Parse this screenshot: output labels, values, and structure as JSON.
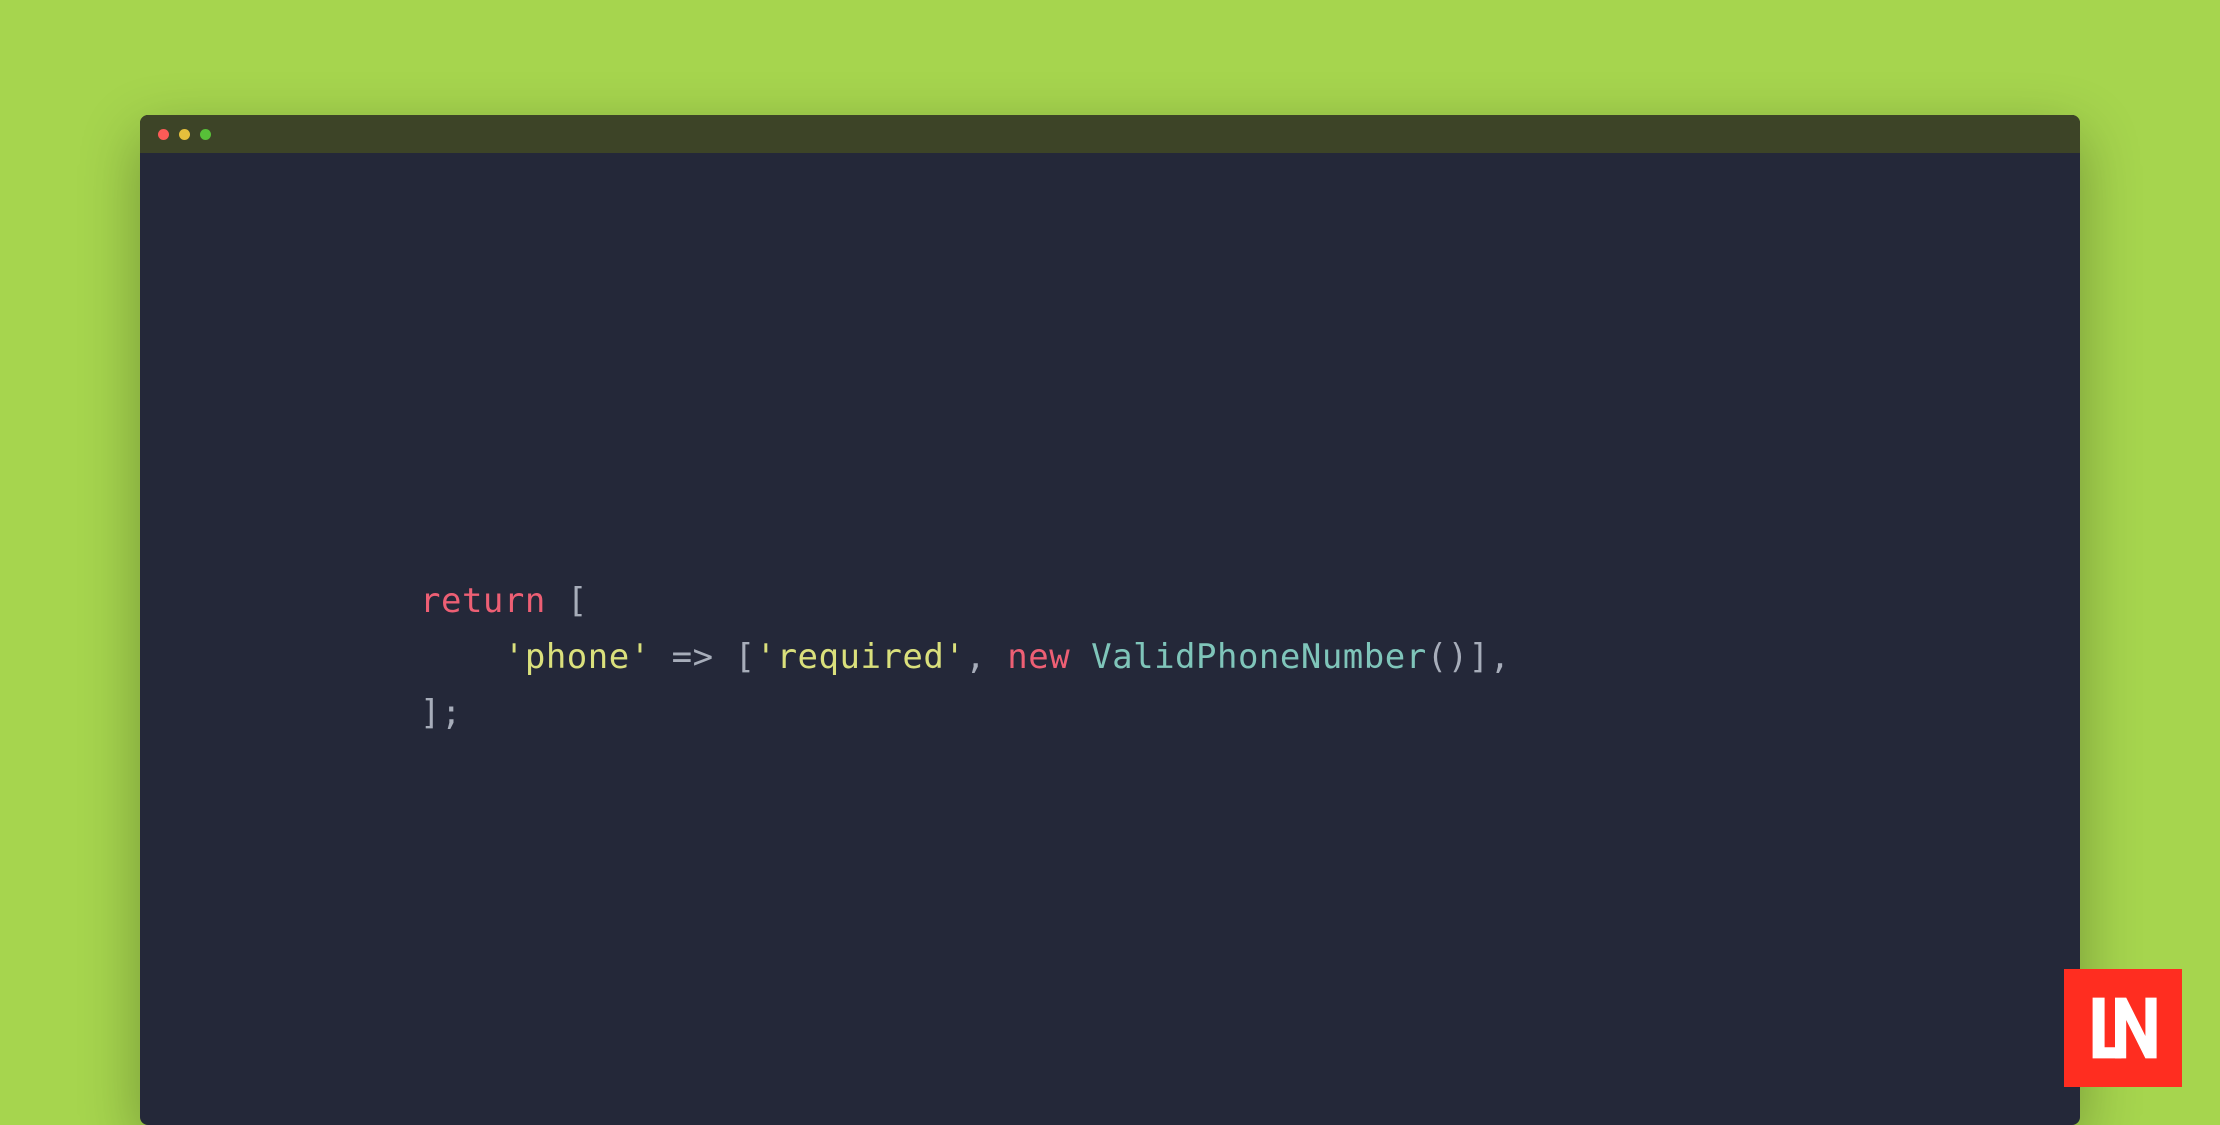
{
  "colors": {
    "background": "#a6d54e",
    "editor_bg": "#242839",
    "titlebar_bg": "#3d4427",
    "traffic_red": "#fc5b57",
    "traffic_yellow": "#e5bf3c",
    "traffic_green": "#57c038",
    "keyword": "#ed5f74",
    "string": "#dae07c",
    "punctuation": "#a7adba",
    "classname": "#7fc5ba",
    "logo_bg": "#ff2d20"
  },
  "code": {
    "line1": {
      "return": "return",
      "space": " ",
      "bracket": "["
    },
    "line2": {
      "indent": "    ",
      "string_phone": "'phone'",
      "space1": " ",
      "arrow": "=>",
      "space2": " ",
      "bracket_open": "[",
      "string_required": "'required'",
      "comma1": ",",
      "space3": " ",
      "new": "new",
      "space4": " ",
      "classname": "ValidPhoneNumber",
      "parens": "()",
      "bracket_close": "]",
      "comma2": ","
    },
    "line3": {
      "bracket": "]",
      "semicolon": ";"
    }
  },
  "logo": {
    "text": "LN"
  }
}
